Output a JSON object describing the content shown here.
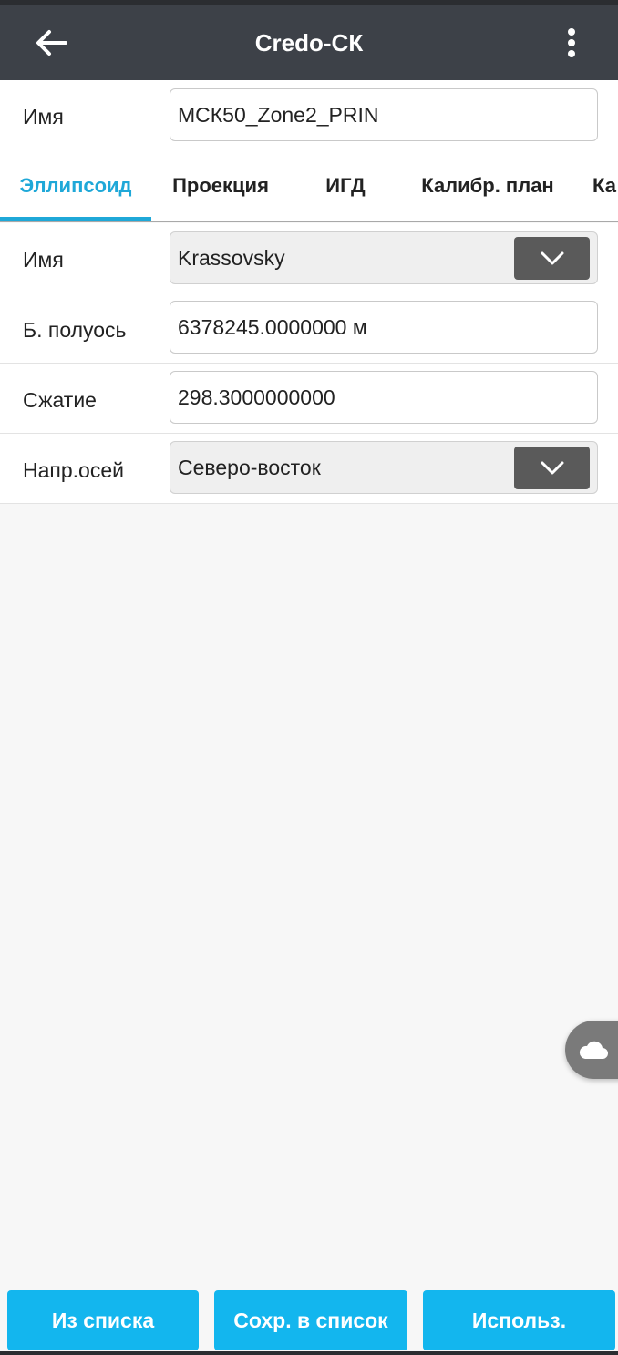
{
  "appbar": {
    "title": "Credo-СК",
    "back_icon": "arrow-left-icon",
    "more_icon": "more-vert-icon"
  },
  "name_field": {
    "label": "Имя",
    "value": "МСК50_Zone2_PRIN"
  },
  "tabs": [
    {
      "label": "Эллипсоид",
      "active": true
    },
    {
      "label": "Проекция",
      "active": false
    },
    {
      "label": "ИГД",
      "active": false
    },
    {
      "label": "Калибр. план",
      "active": false
    },
    {
      "label": "Ка",
      "active": false
    }
  ],
  "ellipsoid": {
    "name": {
      "label": "Имя",
      "value": "Krassovsky"
    },
    "semi_axis": {
      "label": "Б. полуось",
      "value": "6378245.0000000 м"
    },
    "flattening": {
      "label": "Сжатие",
      "value": "298.3000000000"
    },
    "axis_direction": {
      "label": "Напр.осей",
      "value": "Северо-восток"
    }
  },
  "buttons": {
    "from_list": "Из списка",
    "save_to_list": "Сохр. в список",
    "use": "Использ."
  },
  "floating": {
    "icon": "cloud-icon"
  },
  "colors": {
    "appbar": "#3d4148",
    "accent": "#1fa8d8",
    "button": "#13b6ee"
  }
}
